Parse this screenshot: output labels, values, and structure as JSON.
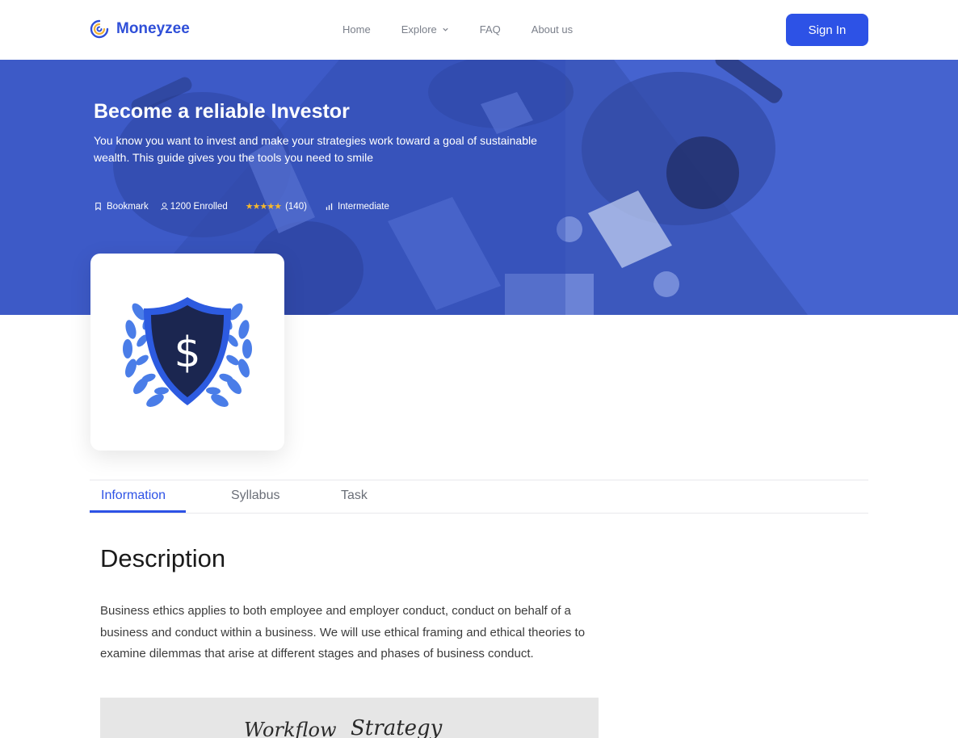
{
  "brand": {
    "name": "Moneyzee",
    "accent": "#2d52e6",
    "logo_icon": "spiral-logo-icon"
  },
  "nav": {
    "links": [
      {
        "label": "Home"
      },
      {
        "label": "Explore",
        "icon": "chevron-down-icon"
      },
      {
        "label": "FAQ"
      },
      {
        "label": "About us"
      }
    ],
    "signin_label": "Sign In"
  },
  "hero": {
    "title": "Become a reliable Investor",
    "subtitle": "You know you want to invest and make your strategies work toward a goal of sustainable wealth. This guide gives you the tools you need to smile",
    "bookmark_label": "Bookmark",
    "enrolled_label": "1200 Enrolled",
    "rating_stars": "★★★★★",
    "rating_count": "(140)",
    "level_label": "Intermediate",
    "overlay_color": "#3f5dc8"
  },
  "card": {
    "icon": "dollar-shield-laurel-icon"
  },
  "tabs": [
    {
      "label": "Information",
      "active": true
    },
    {
      "label": "Syllabus",
      "active": false
    },
    {
      "label": "Task",
      "active": false
    }
  ],
  "description": {
    "title": "Description",
    "body": "Business ethics applies to both employee and employer conduct, conduct on behalf of a business and conduct within a business. We will use ethical framing and ethical theories to examine dilemmas that arise at different stages and phases of business conduct.",
    "image_text_1": "Workflow",
    "image_text_2": "Strategy"
  }
}
